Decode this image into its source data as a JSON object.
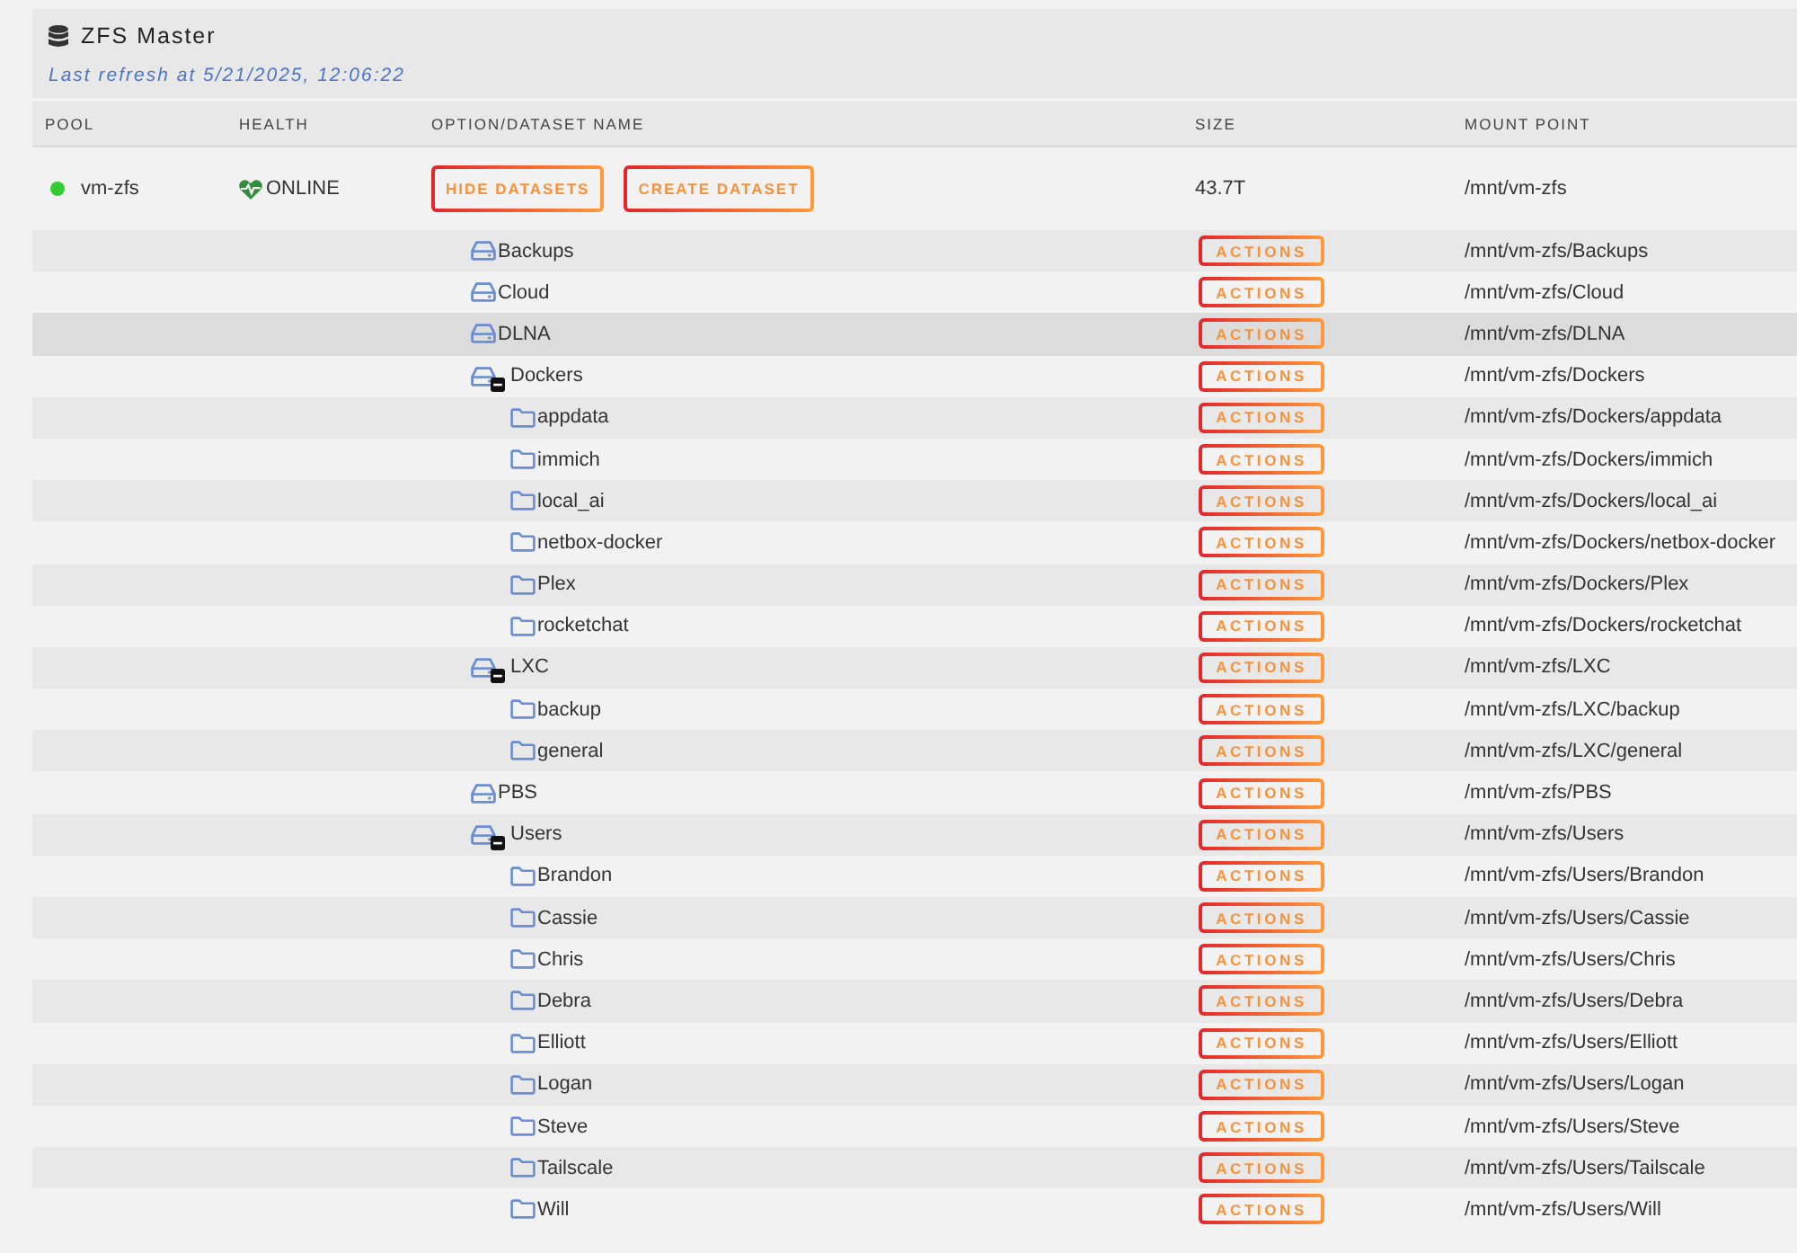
{
  "panel": {
    "title": "ZFS Master",
    "last_refresh": "Last refresh at 5/21/2025, 12:06:22"
  },
  "columns": [
    "POOL",
    "HEALTH",
    "OPTION/DATASET NAME",
    "SIZE",
    "MOUNT POINT"
  ],
  "pools": [
    {
      "name": "vm-zfs",
      "color": "#33cc33",
      "health": "ONLINE",
      "buttons": [
        "HIDE DATASETS",
        "CREATE DATASET"
      ],
      "size": "43.7T",
      "mount_point": "/mnt/vm-zfs",
      "datasets": [
        {
          "name": "Backups",
          "action": "ACTIONS",
          "mount_point": "/mnt/vm-zfs/Backups",
          "selected": false,
          "expanded": false
        },
        {
          "name": "Cloud",
          "action": "ACTIONS",
          "mount_point": "/mnt/vm-zfs/Cloud",
          "selected": false,
          "expanded": false
        },
        {
          "name": "DLNA",
          "action": "ACTIONS",
          "mount_point": "/mnt/vm-zfs/DLNA",
          "selected": true,
          "expanded": false
        },
        {
          "name": "Dockers",
          "action": "ACTIONS",
          "mount_point": "/mnt/vm-zfs/Dockers",
          "selected": false,
          "expanded": true,
          "children": [
            {
              "name": "appdata",
              "action": "ACTIONS",
              "mount_point": "/mnt/vm-zfs/Dockers/appdata",
              "selected": false
            },
            {
              "name": "immich",
              "action": "ACTIONS",
              "mount_point": "/mnt/vm-zfs/Dockers/immich",
              "selected": false
            },
            {
              "name": "local_ai",
              "action": "ACTIONS",
              "mount_point": "/mnt/vm-zfs/Dockers/local_ai",
              "selected": false
            },
            {
              "name": "netbox-docker",
              "action": "ACTIONS",
              "mount_point": "/mnt/vm-zfs/Dockers/netbox-docker",
              "selected": false
            },
            {
              "name": "Plex",
              "action": "ACTIONS",
              "mount_point": "/mnt/vm-zfs/Dockers/Plex",
              "selected": false
            },
            {
              "name": "rocketchat",
              "action": "ACTIONS",
              "mount_point": "/mnt/vm-zfs/Dockers/rocketchat",
              "selected": false
            }
          ]
        },
        {
          "name": "LXC",
          "action": "ACTIONS",
          "mount_point": "/mnt/vm-zfs/LXC",
          "selected": false,
          "expanded": true,
          "children": [
            {
              "name": "backup",
              "action": "ACTIONS",
              "mount_point": "/mnt/vm-zfs/LXC/backup",
              "selected": false
            },
            {
              "name": "general",
              "action": "ACTIONS",
              "mount_point": "/mnt/vm-zfs/LXC/general",
              "selected": false
            }
          ]
        },
        {
          "name": "PBS",
          "action": "ACTIONS",
          "mount_point": "/mnt/vm-zfs/PBS",
          "selected": false,
          "expanded": false
        },
        {
          "name": "Users",
          "action": "ACTIONS",
          "mount_point": "/mnt/vm-zfs/Users",
          "selected": false,
          "expanded": true,
          "children": [
            {
              "name": "Brandon",
              "action": "ACTIONS",
              "mount_point": "/mnt/vm-zfs/Users/Brandon",
              "selected": false
            },
            {
              "name": "Cassie",
              "action": "ACTIONS",
              "mount_point": "/mnt/vm-zfs/Users/Cassie",
              "selected": false
            },
            {
              "name": "Chris",
              "action": "ACTIONS",
              "mount_point": "/mnt/vm-zfs/Users/Chris",
              "selected": false
            },
            {
              "name": "Debra",
              "action": "ACTIONS",
              "mount_point": "/mnt/vm-zfs/Users/Debra",
              "selected": false
            },
            {
              "name": "Elliott",
              "action": "ACTIONS",
              "mount_point": "/mnt/vm-zfs/Users/Elliott",
              "selected": false
            },
            {
              "name": "Logan",
              "action": "ACTIONS",
              "mount_point": "/mnt/vm-zfs/Users/Logan",
              "selected": false
            },
            {
              "name": "Steve",
              "action": "ACTIONS",
              "mount_point": "/mnt/vm-zfs/Users/Steve",
              "selected": false
            },
            {
              "name": "Tailscale",
              "action": "ACTIONS",
              "mount_point": "/mnt/vm-zfs/Users/Tailscale",
              "selected": false
            },
            {
              "name": "Will",
              "action": "ACTIONS",
              "mount_point": "/mnt/vm-zfs/Users/Will",
              "selected": false
            }
          ]
        }
      ]
    }
  ]
}
